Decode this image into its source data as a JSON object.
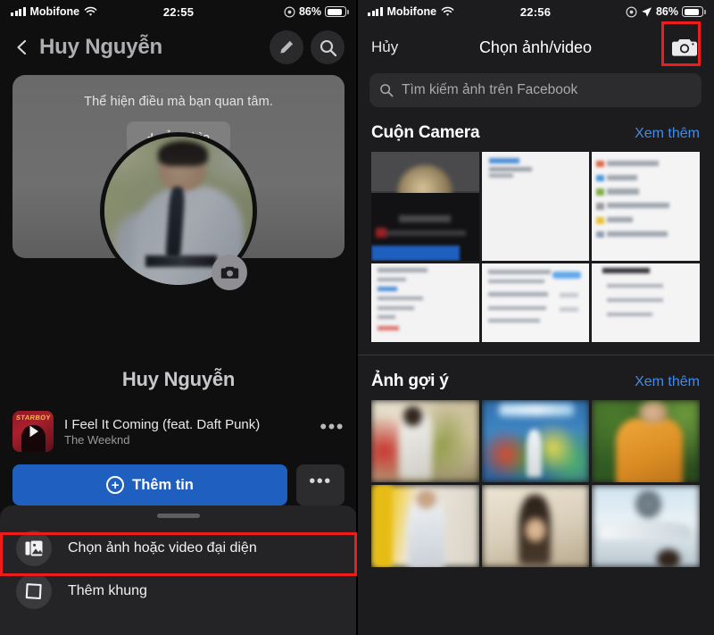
{
  "left_panel": {
    "status_bar": {
      "carrier": "Mobifone",
      "signal_icon": "signal-bars-icon",
      "wifi_icon": "wifi-icon",
      "time": "22:55",
      "alarm_icon": "alarm-icon",
      "battery_percent": "86%",
      "battery_icon": "battery-icon"
    },
    "nav": {
      "back_icon": "chevron-left-icon",
      "title": "Huy Nguyễn",
      "edit_icon": "pencil-icon",
      "search_icon": "search-icon"
    },
    "cover": {
      "prompt": "Thể hiện điều mà bạn quan tâm.",
      "add_cover_label": "Ảnh bìa",
      "plus": "+",
      "avatar_name": "avatar-photo",
      "avatar_camera_icon": "camera-icon"
    },
    "profile_name": "Huy Nguyễn",
    "music": {
      "album_badge": "STARBOY",
      "play_icon": "play-icon",
      "title": "I Feel It Coming (feat. Daft Punk)",
      "artist": "The Weeknd",
      "overflow": "•••"
    },
    "cta": {
      "primary_label": "Thêm tin",
      "primary_plus_icon": "plus-circle-icon",
      "primary_color": "#1f5fbf",
      "more_label": "•••"
    },
    "sheet": {
      "drag_handle": "drag-handle",
      "items": [
        {
          "label": "Chọn ảnh hoặc video đại diện",
          "icon": "photo-stack-icon",
          "highlighted": true
        },
        {
          "label": "Thêm khung",
          "icon": "frame-icon",
          "highlighted": false
        }
      ]
    }
  },
  "right_panel": {
    "status_bar": {
      "carrier": "Mobifone",
      "signal_icon": "signal-bars-icon",
      "wifi_icon": "wifi-icon",
      "time": "22:56",
      "alarm_icon": "alarm-icon",
      "location_icon": "location-arrow-icon",
      "battery_percent": "86%",
      "battery_icon": "battery-icon"
    },
    "nav": {
      "cancel_label": "Hủy",
      "title": "Chọn ảnh/video",
      "camera_icon": "camera-icon",
      "camera_highlighted": true
    },
    "search": {
      "placeholder": "Tìm kiếm ảnh trên Facebook",
      "icon": "search-icon"
    },
    "sections": [
      {
        "title": "Cuộn Camera",
        "see_more": "Xem thêm",
        "thumb_count": 6,
        "thumb_kind": "screenshot-grid"
      },
      {
        "title": "Ảnh gợi ý",
        "see_more": "Xem thêm",
        "thumb_count": 6,
        "thumb_kind": "photo-grid"
      }
    ]
  },
  "annotations": {
    "highlight_color": "#ee1c1c",
    "boxes": [
      {
        "name": "camera-button-highlight",
        "panel": "right"
      },
      {
        "name": "choose-profile-photo-highlight",
        "panel": "left"
      }
    ]
  }
}
